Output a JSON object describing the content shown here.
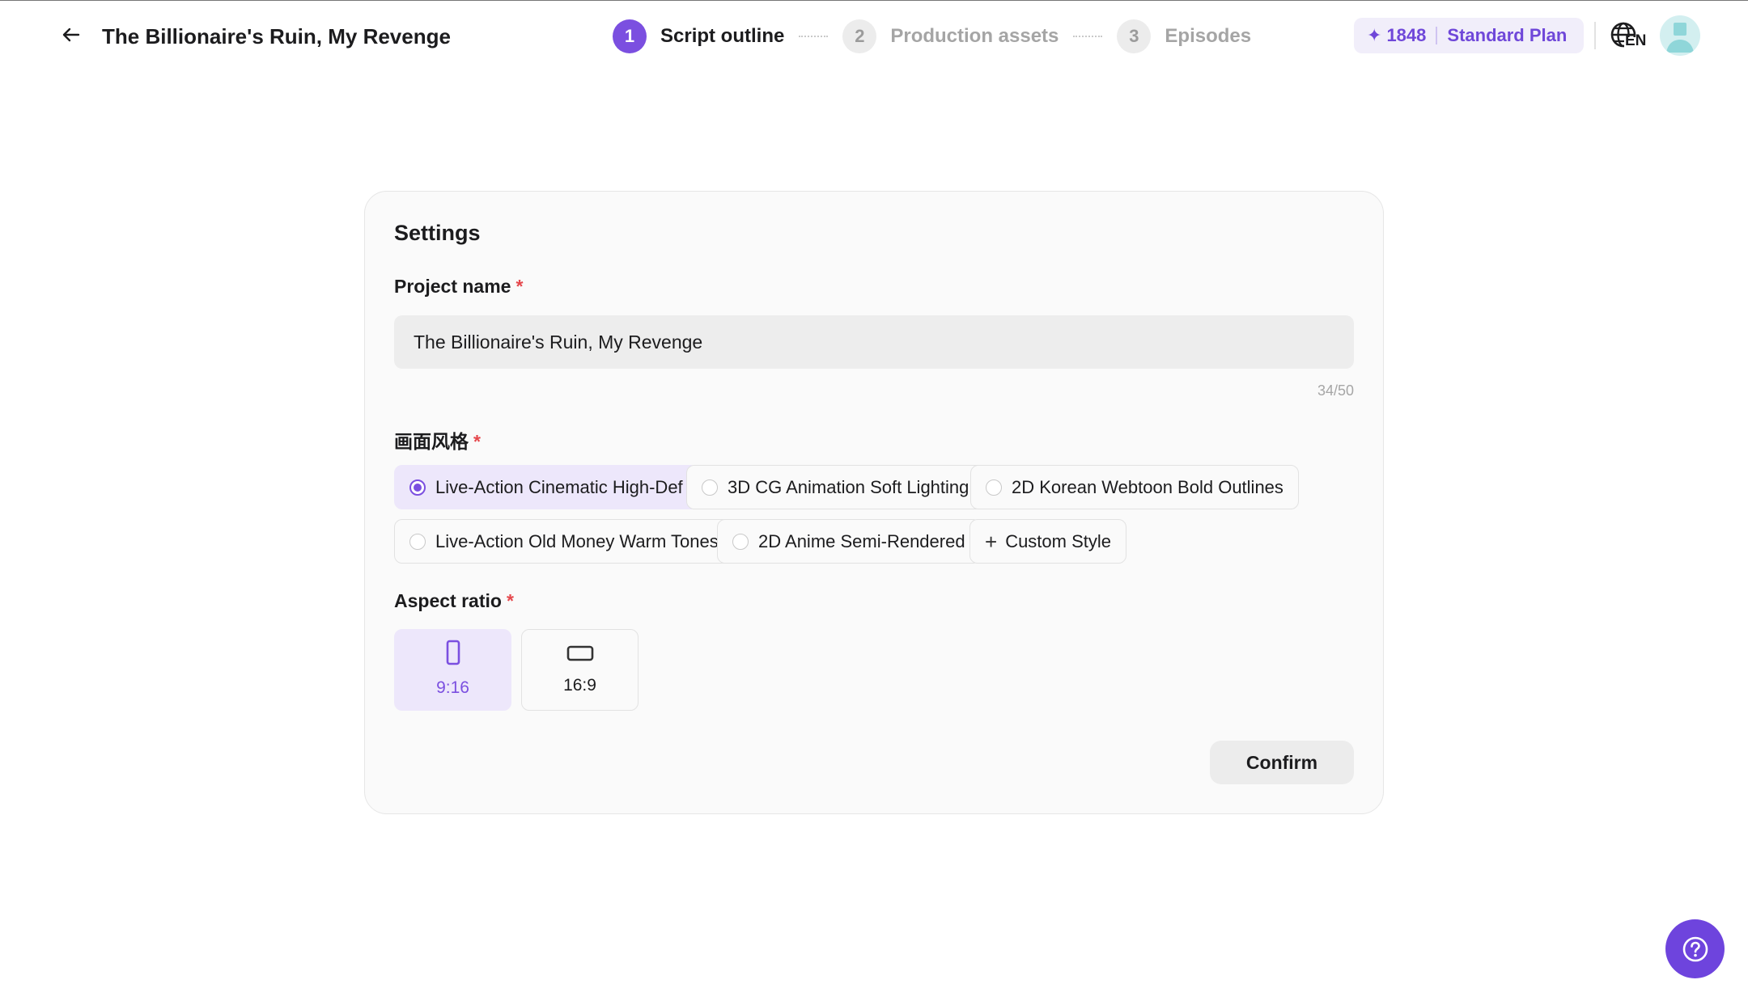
{
  "header": {
    "project_title": "The Billionaire's Ruin, My Revenge",
    "steps": [
      {
        "number": "1",
        "label": "Script outline",
        "active": true
      },
      {
        "number": "2",
        "label": "Production assets",
        "active": false
      },
      {
        "number": "3",
        "label": "Episodes",
        "active": false
      }
    ],
    "credits": {
      "count": "1848",
      "plan": "Standard Plan",
      "icon": "sparkle-icon"
    },
    "language": "EN",
    "accent_color": "#7b4fe0"
  },
  "settings": {
    "title": "Settings",
    "project_name": {
      "label": "Project name",
      "required_mark": "*",
      "value": "The Billionaire's Ruin, My Revenge",
      "counter": "34/50"
    },
    "style": {
      "label": "画面风格",
      "required_mark": "*",
      "options": [
        {
          "label": "Live-Action Cinematic High-Def",
          "selected": true
        },
        {
          "label": "3D CG Animation Soft Lighting",
          "selected": false
        },
        {
          "label": "2D Korean Webtoon Bold Outlines",
          "selected": false
        },
        {
          "label": "Live-Action Old Money Warm Tones",
          "selected": false
        },
        {
          "label": "2D Anime Semi-Rendered",
          "selected": false
        }
      ],
      "custom_label": "Custom Style"
    },
    "aspect_ratio": {
      "label": "Aspect ratio",
      "required_mark": "*",
      "options": [
        {
          "label": "9:16",
          "icon": "portrait-ratio-icon",
          "selected": true
        },
        {
          "label": "16:9",
          "icon": "landscape-ratio-icon",
          "selected": false
        }
      ]
    },
    "confirm_label": "Confirm"
  }
}
